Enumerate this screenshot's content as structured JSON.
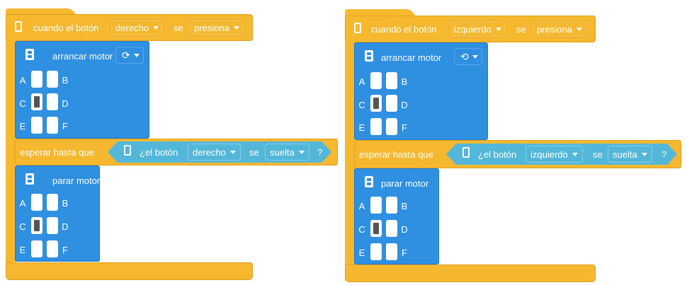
{
  "scripts": [
    {
      "event": {
        "label": "cuando el botón",
        "button": "derecho",
        "se": "se",
        "action": "presiona"
      },
      "start": {
        "label": "arrancar motor",
        "direction_icon": "rotate-clockwise-icon"
      },
      "ports_left": [
        "A",
        "C",
        "E"
      ],
      "ports_right": [
        "B",
        "D",
        "F"
      ],
      "wait": {
        "label": "esperar hasta que",
        "question": "¿el botón",
        "button": "derecho",
        "se": "se",
        "state": "suelta",
        "qmark": "?"
      },
      "stop": {
        "label": "parar motor"
      }
    },
    {
      "event": {
        "label": "cuando el botón",
        "button": "izquierdo",
        "se": "se",
        "action": "presiona"
      },
      "start": {
        "label": "arrancar motor",
        "direction_icon": "rotate-counterclockwise-icon"
      },
      "ports_left": [
        "A",
        "C",
        "E"
      ],
      "ports_right": [
        "B",
        "D",
        "F"
      ],
      "wait": {
        "label": "esperar hasta que",
        "question": "¿el botón",
        "button": "izquierdo",
        "se": "se",
        "state": "suelta",
        "qmark": "?"
      },
      "stop": {
        "label": "parar motor"
      }
    }
  ],
  "active_port": "C",
  "colors": {
    "event": "#f5b82e",
    "motor": "#2f8fe0",
    "sensor": "#52b7d8"
  }
}
